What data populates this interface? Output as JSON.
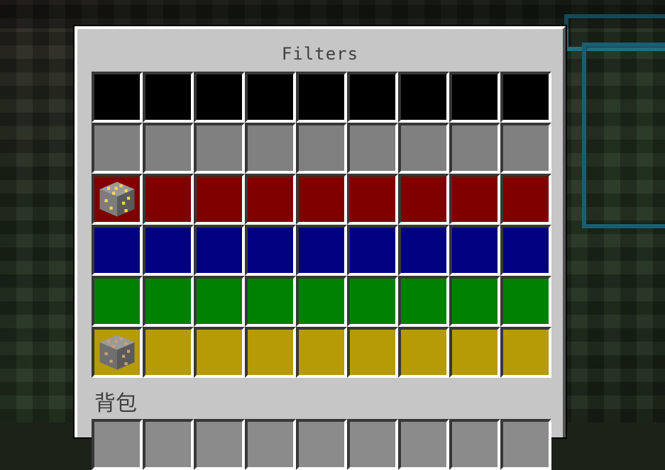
{
  "screen": {
    "title": "Filters",
    "inventory_label": "背包"
  },
  "filter_rows": [
    {
      "color": "#000000",
      "items": [
        null,
        null,
        null,
        null,
        null,
        null,
        null,
        null,
        null
      ]
    },
    {
      "color": "#808080",
      "items": [
        null,
        null,
        null,
        null,
        null,
        null,
        null,
        null,
        null
      ]
    },
    {
      "color": "#800000",
      "items": [
        "gold-ore-icon",
        null,
        null,
        null,
        null,
        null,
        null,
        null,
        null
      ]
    },
    {
      "color": "#000080",
      "items": [
        null,
        null,
        null,
        null,
        null,
        null,
        null,
        null,
        null
      ]
    },
    {
      "color": "#008000",
      "items": [
        null,
        null,
        null,
        null,
        null,
        null,
        null,
        null,
        null
      ]
    },
    {
      "color": "#b69a06",
      "items": [
        "iron-ore-icon",
        null,
        null,
        null,
        null,
        null,
        null,
        null,
        null
      ]
    }
  ],
  "item_colors": {
    "gold-ore-icon": {
      "base": "#7d7d7d",
      "speck": "#f5d84a"
    },
    "iron-ore-icon": {
      "base": "#6f6f6f",
      "speck": "#c9a07a"
    }
  },
  "inventory_row_slots": 9
}
